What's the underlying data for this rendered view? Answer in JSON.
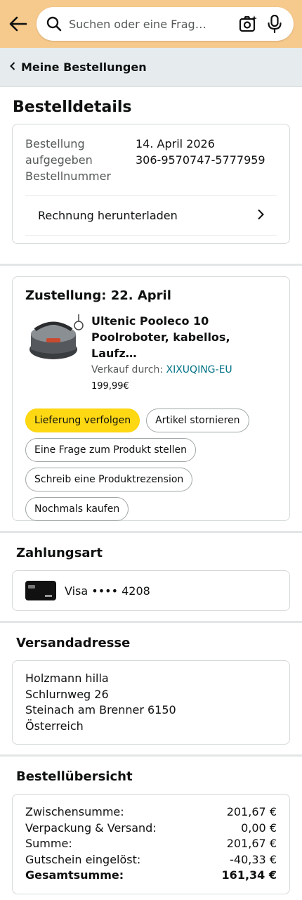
{
  "search": {
    "placeholder": "Suchen oder eine Frag…"
  },
  "breadcrumb": {
    "label": "Meine Bestellungen"
  },
  "page": {
    "title": "Bestelldetails"
  },
  "order": {
    "label_placed": "Bestellung aufgegeben",
    "label_number": "Bestellnummer",
    "date": "14. April 2026",
    "number": "306-9570747-5777959",
    "invoice_label": "Rechnung herunterladen"
  },
  "delivery": {
    "heading": "Zustellung: 22. April",
    "product_name": "Ultenic Pooleco 10 Poolroboter, kabellos, Laufz…",
    "seller_prefix": "Verkauf durch: ",
    "seller_name": "XIXUQING-EU",
    "price": "199,99€",
    "buttons": {
      "track": "Lieferung verfolgen",
      "cancel": "Artikel stornieren",
      "question": "Eine Frage zum Produkt stellen",
      "review": "Schreib eine Produktrezension",
      "rebuy": "Nochmals kaufen"
    }
  },
  "payment": {
    "title": "Zahlungsart",
    "method": "Visa •••• 4208"
  },
  "shipping": {
    "title": "Versandadresse",
    "lines": [
      "Holzmann hilla",
      "Schlurnweg 26",
      "Steinach am Brenner 6150",
      "Österreich"
    ]
  },
  "summary": {
    "title": "Bestellübersicht",
    "rows": [
      {
        "label": "Zwischensumme:",
        "value": "201,67 €"
      },
      {
        "label": "Verpackung & Versand:",
        "value": "0,00 €"
      },
      {
        "label": "Summe:",
        "value": "201,67 €"
      },
      {
        "label": "Gutschein eingelöst:",
        "value": "-40,33 €"
      }
    ],
    "total_label": "Gesamtsumme:",
    "total_value": "161,34 €"
  },
  "colors": {
    "header_bg": "#f6c98c",
    "primary_button": "#ffd814",
    "link": "#007185"
  },
  "icons": [
    "back-arrow-icon",
    "search-icon",
    "camera-search-icon",
    "microphone-icon",
    "chevron-left-icon",
    "chevron-right-icon",
    "visa-card-icon"
  ]
}
